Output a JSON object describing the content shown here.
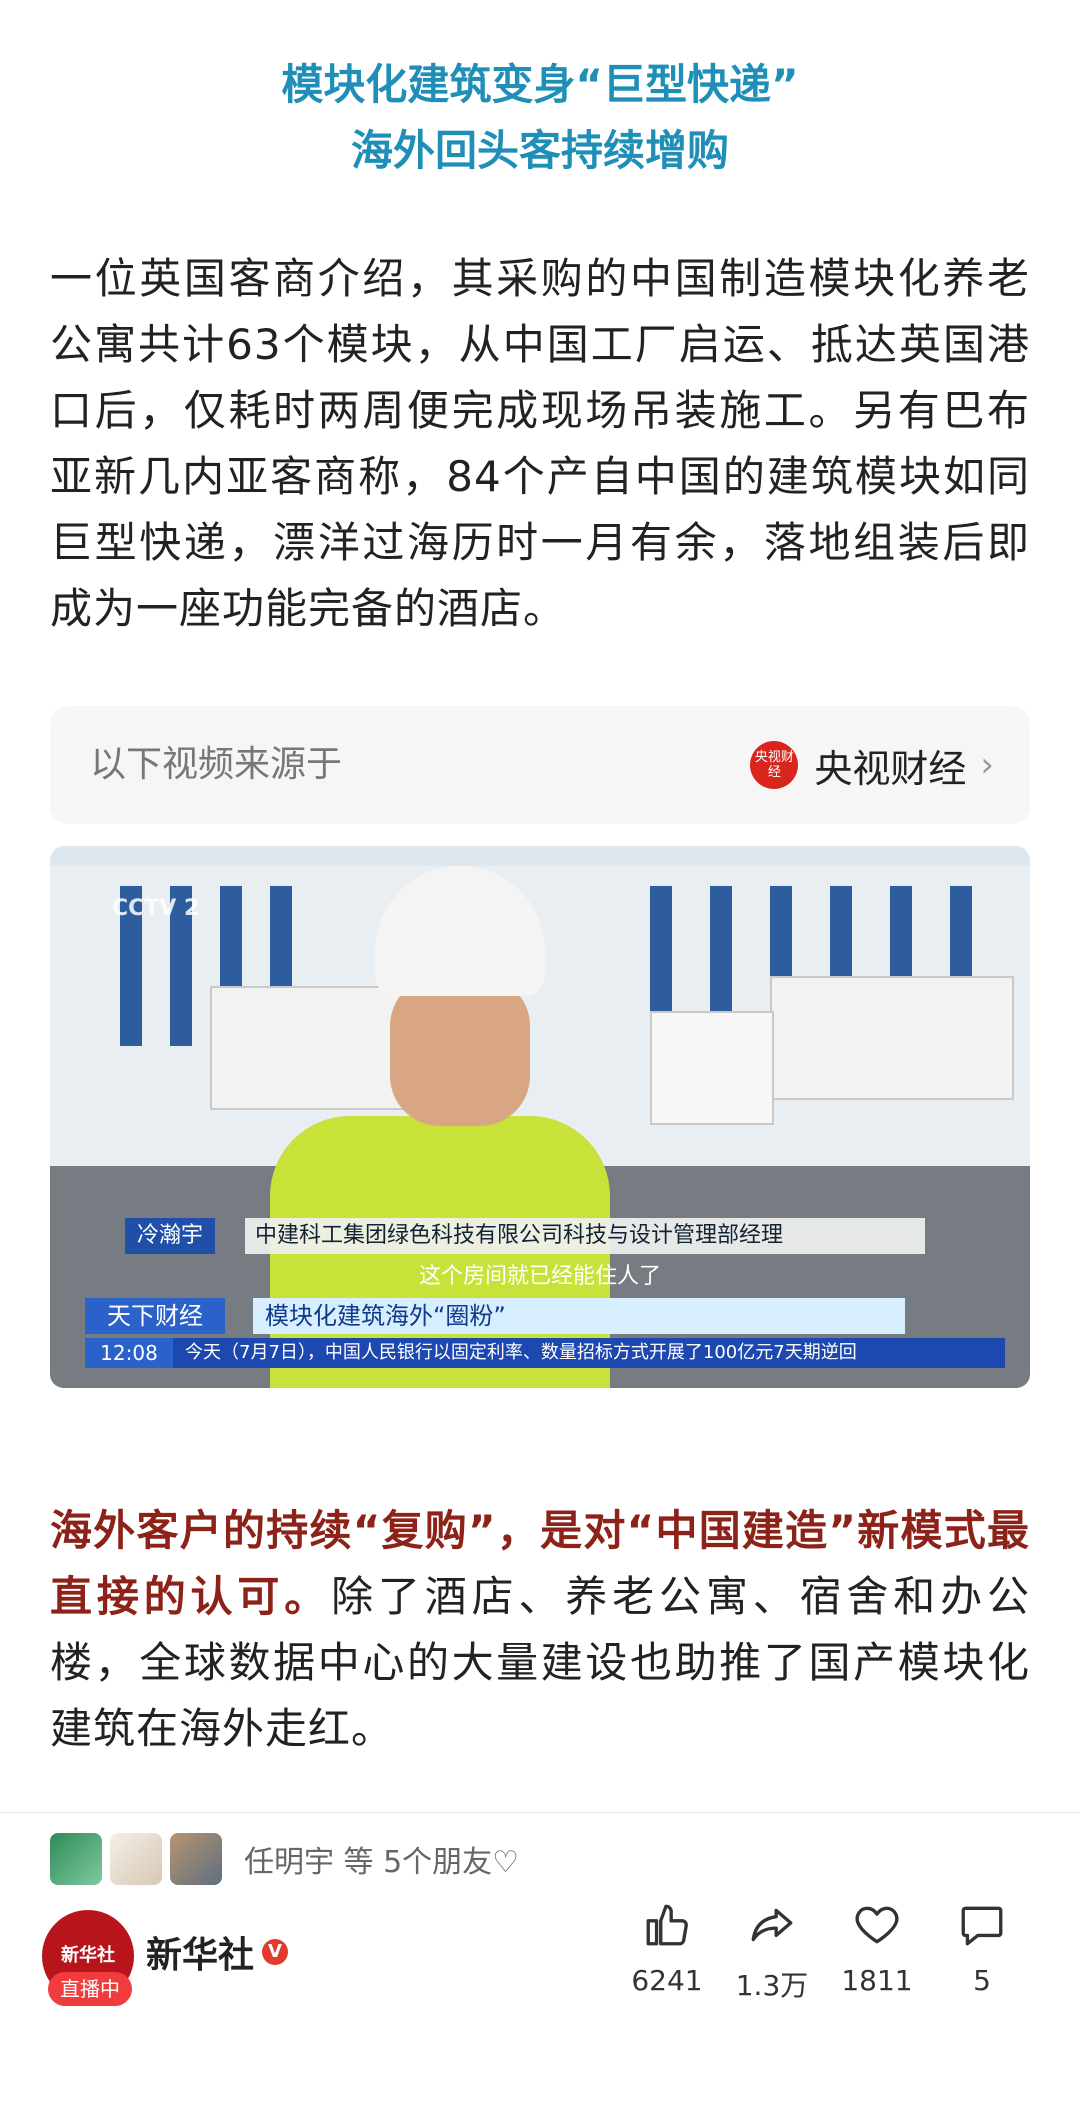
{
  "article": {
    "title_line1": "模块化建筑变身“巨型快递”",
    "title_line2": "海外回头客持续增购",
    "paragraph1": "一位英国客商介绍，其采购的中国制造模块化养老公寓共计63个模块，从中国工厂启运、抵达英国港口后，仅耗时两周便完成现场吊装施工。另有巴布亚新几内亚客商称，84个产自中国的建筑模块如同巨型快递，漂洋过海历时一月有余，落地组装后即成为一座功能完备的酒店。",
    "paragraph2_emphasis": "海外客户的持续“复购”，是对“中国建造”新模式最直接的认可。",
    "paragraph2_rest": "除了酒店、养老公寓、宿舍和办公楼，全球数据中心的大量建设也助推了国产模块化建筑在海外走红。"
  },
  "video_source": {
    "label": "以下视频来源于",
    "channel_logo_text": "央视财经",
    "channel_name": "央视财经",
    "chevron": "›"
  },
  "video": {
    "watermark": "CCTV 2",
    "person_name": "冷瀚宇",
    "person_role": "中建科工集团绿色科技有限公司科技与设计管理部经理",
    "subtitle": "这个房间就已经能住人了",
    "program_name": "天下财经",
    "program_title": "模块化建筑海外“圈粉”",
    "clock": "12:08",
    "ticker": "今天（7月7日），中国人民银行以固定利率、数量招标方式开展了100亿元7天期逆回"
  },
  "friends": {
    "text": "任明宇 等 5个朋友♡"
  },
  "author": {
    "avatar_text": "新华社",
    "live_badge": "直播中",
    "name": "新华社",
    "verified": "V"
  },
  "actions": {
    "like_count": "6241",
    "share_count": "1.3万",
    "favorite_count": "1811",
    "comment_count": "5"
  },
  "colors": {
    "title": "#1f8fb8",
    "emphasis": "#8c2218",
    "brand_red": "#d8261c"
  }
}
